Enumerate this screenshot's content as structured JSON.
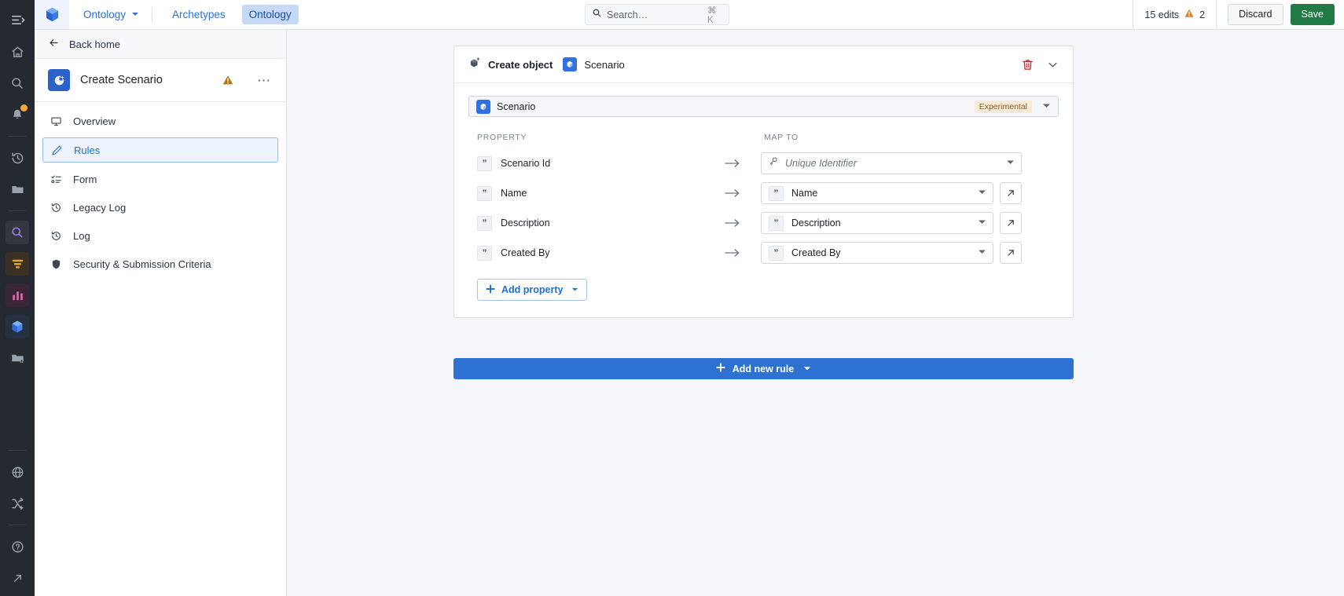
{
  "rail": {
    "items": [
      {
        "name": "sidebar-toggle-icon",
        "icon": "menu-collapse"
      },
      {
        "name": "home-icon",
        "icon": "home"
      },
      {
        "name": "search-icon",
        "icon": "search"
      },
      {
        "name": "notifications-icon",
        "icon": "bell",
        "badge": true
      },
      {
        "name": "history-icon",
        "icon": "history"
      },
      {
        "name": "folder-icon",
        "icon": "folder"
      },
      {
        "name": "quiver-search-icon",
        "icon": "search-app",
        "state": "purple"
      },
      {
        "name": "pipeline-icon",
        "icon": "funnel",
        "state": "orange"
      },
      {
        "name": "charts-icon",
        "icon": "bar-chart",
        "state": "pink"
      },
      {
        "name": "ontology-icon",
        "icon": "cube",
        "state": "blue"
      },
      {
        "name": "starred-folder-icon",
        "icon": "folder-star"
      },
      {
        "name": "globe-icon",
        "icon": "globe"
      },
      {
        "name": "shuffle-icon",
        "icon": "shuffle"
      },
      {
        "name": "help-icon",
        "icon": "help"
      },
      {
        "name": "expand-icon",
        "icon": "arrow-up-right"
      }
    ]
  },
  "topbar": {
    "product_menu": "Ontology",
    "tabs": [
      {
        "label": "Archetypes",
        "active": false
      },
      {
        "label": "Ontology",
        "active": true
      }
    ],
    "search": {
      "placeholder": "Search…",
      "value": "",
      "shortcut": "⌘ K"
    },
    "edits_label": "15 edits",
    "warning_count": "2",
    "discard_label": "Discard",
    "save_label": "Save",
    "colors": {
      "brand_blue": "#2d72d2",
      "save_green": "#1f7a43",
      "warning_orange": "#d9822b"
    }
  },
  "sidebar": {
    "back_home": "Back home",
    "title": "Create Scenario",
    "items": [
      {
        "label": "Overview",
        "icon": "desktop",
        "active": false
      },
      {
        "label": "Rules",
        "icon": "pencil",
        "active": true
      },
      {
        "label": "Form",
        "icon": "form",
        "active": false
      },
      {
        "label": "Legacy Log",
        "icon": "history",
        "active": false
      },
      {
        "label": "Log",
        "icon": "history",
        "active": false
      },
      {
        "label": "Security & Submission Criteria",
        "icon": "shield",
        "active": false
      }
    ]
  },
  "main": {
    "rule": {
      "header_action": "Create object",
      "header_object": "Scenario",
      "object_select": {
        "value": "Scenario",
        "badge": "Experimental"
      },
      "columns": {
        "property": "PROPERTY",
        "map_to": "MAP TO"
      },
      "rows": [
        {
          "property": "Scenario Id",
          "map_to_value": "",
          "map_to_placeholder": "Unique Identifier",
          "map_to_icon": "key-icon",
          "has_external_link": false
        },
        {
          "property": "Name",
          "map_to_value": "Name",
          "map_to_placeholder": "",
          "map_to_icon": "string-icon",
          "has_external_link": true
        },
        {
          "property": "Description",
          "map_to_value": "Description",
          "map_to_placeholder": "",
          "map_to_icon": "string-icon",
          "has_external_link": true
        },
        {
          "property": "Created By",
          "map_to_value": "Created By",
          "map_to_placeholder": "",
          "map_to_icon": "string-icon",
          "has_external_link": true
        }
      ],
      "add_property_label": "Add property"
    },
    "add_new_rule_label": "Add new rule"
  }
}
